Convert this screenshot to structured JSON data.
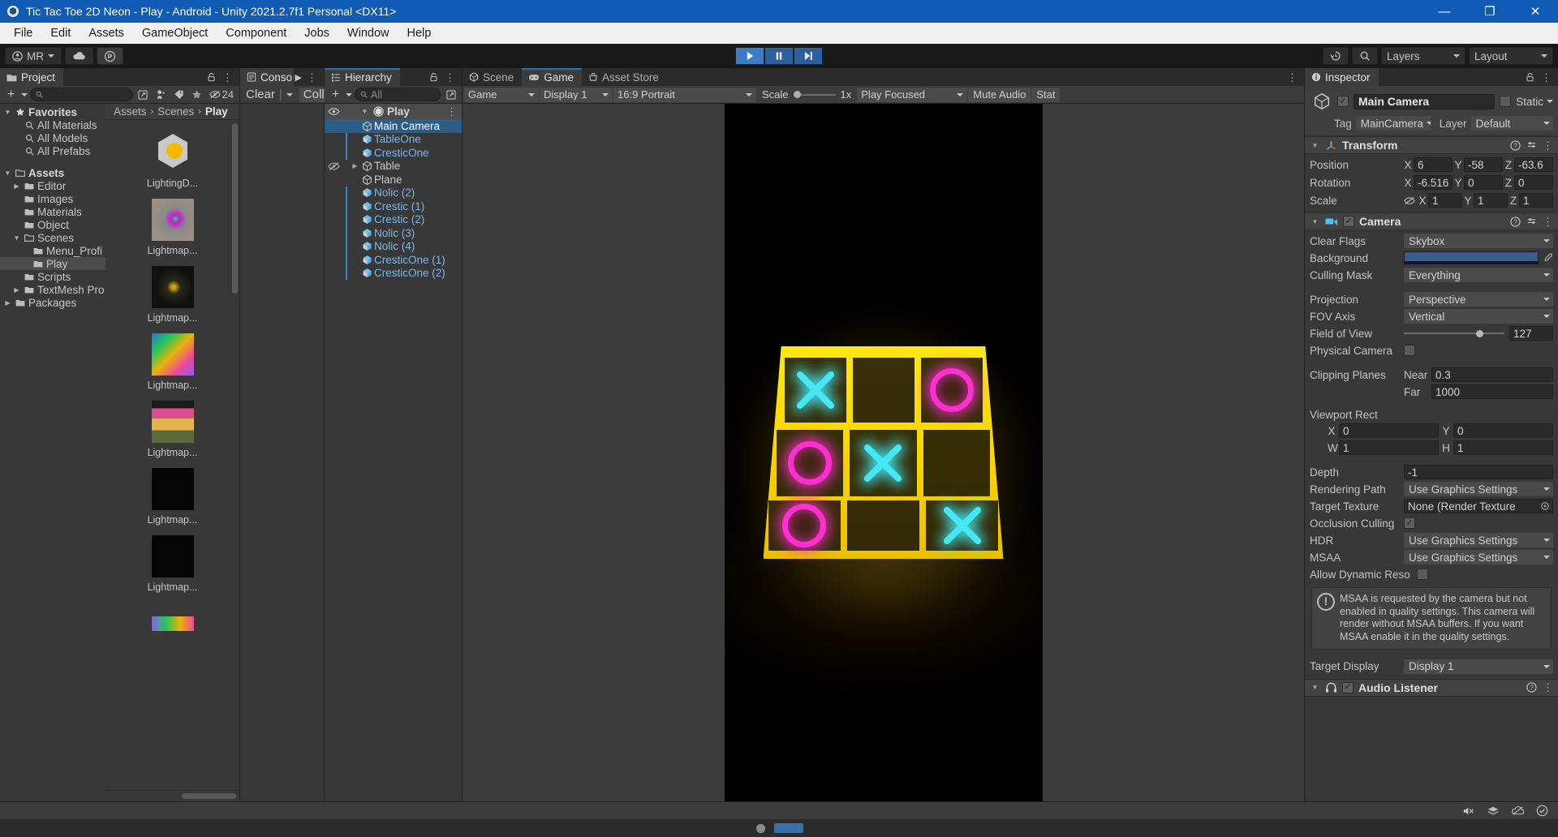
{
  "window": {
    "title": "Tic Tac Toe 2D Neon - Play - Android - Unity 2021.2.7f1 Personal <DX11>",
    "minimize": "—",
    "maximize": "❐",
    "close": "✕"
  },
  "menubar": {
    "items": [
      "File",
      "Edit",
      "Assets",
      "GameObject",
      "Component",
      "Jobs",
      "Window",
      "Help"
    ]
  },
  "toolbar": {
    "account_label": "MR",
    "cloud_icon": "cloud-icon",
    "collab_icon": "collab-icon",
    "play_icon": "play-icon",
    "pause_icon": "pause-icon",
    "step_icon": "step-icon",
    "history_icon": "history-icon",
    "search_icon": "search-icon",
    "layers_label": "Layers",
    "layout_label": "Layout"
  },
  "project": {
    "tab_label": "Project",
    "lock_icon": "lock-icon",
    "menu_icon": "kebab-icon",
    "add_label": "+",
    "search_placeholder": "",
    "hidden_count": "24",
    "tree": [
      {
        "label": "Favorites",
        "depth": 0,
        "arrow": "down",
        "icon": "star-icon",
        "bold": true,
        "selected": false
      },
      {
        "label": "All Materials",
        "depth": 1,
        "arrow": "none",
        "icon": "search-icon",
        "bold": false,
        "selected": false
      },
      {
        "label": "All Models",
        "depth": 1,
        "arrow": "none",
        "icon": "search-icon",
        "bold": false,
        "selected": false
      },
      {
        "label": "All Prefabs",
        "depth": 1,
        "arrow": "none",
        "icon": "search-icon",
        "bold": false,
        "selected": false
      },
      {
        "label": "",
        "depth": 0,
        "arrow": "none",
        "icon": "none",
        "bold": false,
        "selected": false
      },
      {
        "label": "Assets",
        "depth": 0,
        "arrow": "down",
        "icon": "folder-open-icon",
        "bold": true,
        "selected": false
      },
      {
        "label": "Editor",
        "depth": 1,
        "arrow": "right",
        "icon": "folder-icon",
        "bold": false,
        "selected": false
      },
      {
        "label": "Images",
        "depth": 1,
        "arrow": "none",
        "icon": "folder-icon",
        "bold": false,
        "selected": false
      },
      {
        "label": "Materials",
        "depth": 1,
        "arrow": "none",
        "icon": "folder-icon",
        "bold": false,
        "selected": false
      },
      {
        "label": "Object",
        "depth": 1,
        "arrow": "none",
        "icon": "folder-icon",
        "bold": false,
        "selected": false
      },
      {
        "label": "Scenes",
        "depth": 1,
        "arrow": "down",
        "icon": "folder-open-icon",
        "bold": false,
        "selected": false
      },
      {
        "label": "Menu_Profi",
        "depth": 2,
        "arrow": "none",
        "icon": "folder-icon",
        "bold": false,
        "selected": false
      },
      {
        "label": "Play",
        "depth": 2,
        "arrow": "none",
        "icon": "folder-icon",
        "bold": false,
        "selected": true
      },
      {
        "label": "Scripts",
        "depth": 1,
        "arrow": "none",
        "icon": "folder-icon",
        "bold": false,
        "selected": false
      },
      {
        "label": "TextMesh Pro",
        "depth": 1,
        "arrow": "right",
        "icon": "folder-icon",
        "bold": false,
        "selected": false
      },
      {
        "label": "Packages",
        "depth": 0,
        "arrow": "right",
        "icon": "folder-icon",
        "bold": false,
        "selected": false
      }
    ],
    "breadcrumb": [
      "Assets",
      "Scenes",
      "Play"
    ],
    "assets": [
      {
        "name": "LightingD...",
        "thumb": "lighting-settings-icon"
      },
      {
        "name": "Lightmap...",
        "thumb": "lightmap-color-a"
      },
      {
        "name": "Lightmap...",
        "thumb": "lightmap-dark-a"
      },
      {
        "name": "Lightmap...",
        "thumb": "lightmap-color-b"
      },
      {
        "name": "Lightmap...",
        "thumb": "lightmap-color-c"
      },
      {
        "name": "Lightmap...",
        "thumb": "lightmap-black-a"
      },
      {
        "name": "Lightmap...",
        "thumb": "lightmap-black-b"
      },
      {
        "name": "",
        "thumb": "lightmap-color-d"
      }
    ]
  },
  "console": {
    "tab_label": "Conso",
    "overflow_icon": "chevron-right-icon",
    "menu_icon": "kebab-icon",
    "clear_label": "Clear",
    "collapse_label": "Collap"
  },
  "hierarchy": {
    "tab_label": "Hierarchy",
    "lock_icon": "lock-icon",
    "menu_icon": "kebab-icon",
    "add_label": "+",
    "search_placeholder": "All",
    "scene_name": "Play",
    "visibility_icon": "eye-icon",
    "items": [
      {
        "label": "Main Camera",
        "icon": "camera-gameobject-icon",
        "prefab": false,
        "selected": true,
        "rail": false,
        "arrow": "none",
        "hidden": false
      },
      {
        "label": "TableOne",
        "icon": "prefab-icon",
        "prefab": true,
        "selected": false,
        "rail": true,
        "arrow": "none",
        "hidden": false
      },
      {
        "label": "CresticOne",
        "icon": "prefab-icon",
        "prefab": true,
        "selected": false,
        "rail": true,
        "arrow": "none",
        "hidden": false
      },
      {
        "label": "Table",
        "icon": "gameobject-icon",
        "prefab": false,
        "selected": false,
        "rail": false,
        "arrow": "right",
        "hidden": true
      },
      {
        "label": "Plane",
        "icon": "gameobject-icon",
        "prefab": false,
        "selected": false,
        "rail": false,
        "arrow": "none",
        "hidden": false
      },
      {
        "label": "Nolic (2)",
        "icon": "prefab-icon",
        "prefab": true,
        "selected": false,
        "rail": true,
        "arrow": "none",
        "hidden": false
      },
      {
        "label": "Crestic (1)",
        "icon": "prefab-icon",
        "prefab": true,
        "selected": false,
        "rail": true,
        "arrow": "none",
        "hidden": false
      },
      {
        "label": "Crestic (2)",
        "icon": "prefab-icon",
        "prefab": true,
        "selected": false,
        "rail": true,
        "arrow": "none",
        "hidden": false
      },
      {
        "label": "Nolic (3)",
        "icon": "prefab-icon",
        "prefab": true,
        "selected": false,
        "rail": true,
        "arrow": "none",
        "hidden": false
      },
      {
        "label": "Nolic (4)",
        "icon": "prefab-icon",
        "prefab": true,
        "selected": false,
        "rail": true,
        "arrow": "none",
        "hidden": false
      },
      {
        "label": "CresticOne (1)",
        "icon": "prefab-icon",
        "prefab": true,
        "selected": false,
        "rail": true,
        "arrow": "none",
        "hidden": false
      },
      {
        "label": "CresticOne (2)",
        "icon": "prefab-icon",
        "prefab": true,
        "selected": false,
        "rail": true,
        "arrow": "none",
        "hidden": false
      }
    ]
  },
  "center": {
    "tabs": [
      {
        "label": "Scene",
        "icon": "scene-icon",
        "active": false
      },
      {
        "label": "Game",
        "icon": "game-icon",
        "active": true
      },
      {
        "label": "Asset Store",
        "icon": "store-icon",
        "active": false
      }
    ],
    "menu_icon": "kebab-icon",
    "game_mode": "Game",
    "display": "Display 1",
    "aspect": "16:9 Portrait",
    "scale_label": "Scale",
    "scale_value": "1x",
    "play_focus": "Play Focused",
    "mute_audio": "Mute Audio",
    "stats": "Stat"
  },
  "game_board": {
    "cells": [
      [
        "X",
        "",
        "O"
      ],
      [
        "O",
        "X",
        ""
      ],
      [
        "O",
        "",
        "X"
      ]
    ],
    "x_color": "#45e9f5",
    "o_color": "#ff2fd0",
    "frame_color": "#f9d400"
  },
  "inspector": {
    "tab_label": "Inspector",
    "lock_icon": "lock-icon",
    "menu_icon": "kebab-icon",
    "object_name": "Main Camera",
    "enabled": true,
    "static_label": "Static",
    "tag_label": "Tag",
    "tag_value": "MainCamera",
    "layer_label": "Layer",
    "layer_value": "Default",
    "transform": {
      "title": "Transform",
      "position_label": "Position",
      "position": {
        "x": "6",
        "y": "-58",
        "z": "-63.6"
      },
      "rotation_label": "Rotation",
      "rotation": {
        "x": "-6.516",
        "y": "0",
        "z": "0"
      },
      "scale_label": "Scale",
      "scale": {
        "x": "1",
        "y": "1",
        "z": "1"
      }
    },
    "camera": {
      "title": "Camera",
      "enabled": true,
      "clear_flags_label": "Clear Flags",
      "clear_flags": "Skybox",
      "background_label": "Background",
      "background_color": "#3b5c8f",
      "culling_mask_label": "Culling Mask",
      "culling_mask": "Everything",
      "projection_label": "Projection",
      "projection": "Perspective",
      "fov_axis_label": "FOV Axis",
      "fov_axis": "Vertical",
      "field_of_view_label": "Field of View",
      "field_of_view": "127",
      "physical_camera_label": "Physical Camera",
      "physical_camera": false,
      "clipping_planes_label": "Clipping Planes",
      "near_label": "Near",
      "near": "0.3",
      "far_label": "Far",
      "far": "1000",
      "viewport_rect_label": "Viewport Rect",
      "viewport": {
        "x": "0",
        "y": "0",
        "w": "1",
        "h": "1"
      },
      "depth_label": "Depth",
      "depth": "-1",
      "rendering_path_label": "Rendering Path",
      "rendering_path": "Use Graphics Settings",
      "target_texture_label": "Target Texture",
      "target_texture": "None (Render Texture",
      "occlusion_culling_label": "Occlusion Culling",
      "occlusion_culling": true,
      "hdr_label": "HDR",
      "hdr": "Use Graphics Settings",
      "msaa_label": "MSAA",
      "msaa": "Use Graphics Settings",
      "allow_dynamic_label": "Allow Dynamic Reso",
      "allow_dynamic": false,
      "warning": "MSAA is requested by the camera but not enabled in quality settings. This camera will render without MSAA buffers. If you want MSAA enable it in the quality settings.",
      "target_display_label": "Target Display",
      "target_display": "Display 1"
    },
    "audio_listener": {
      "title": "Audio Listener",
      "enabled": true
    }
  },
  "statusbar": {
    "icons": [
      "mute-icon",
      "layers-status-icon",
      "cloud-status-icon",
      "check-status-icon"
    ]
  }
}
